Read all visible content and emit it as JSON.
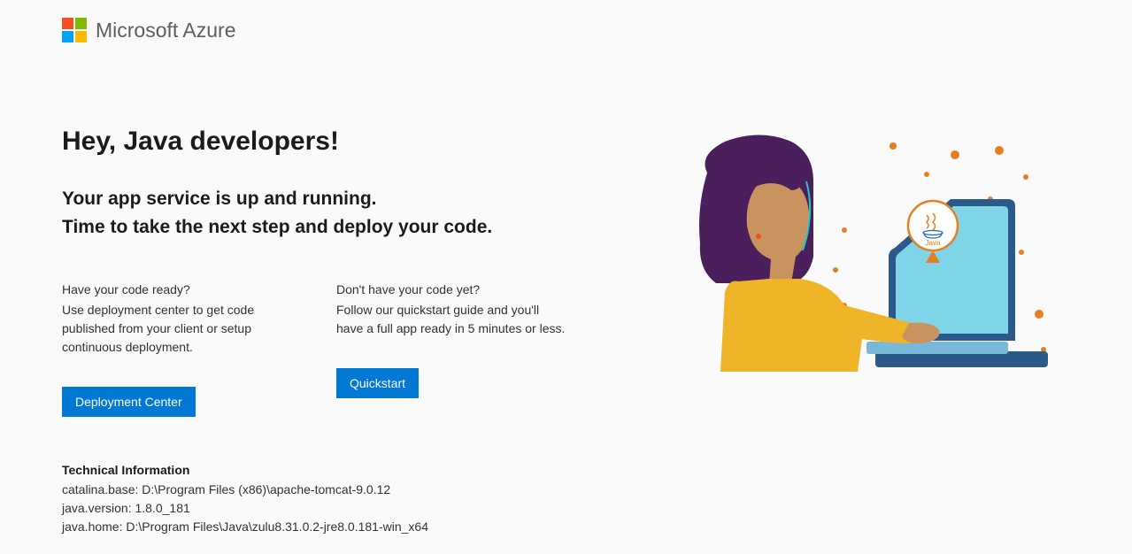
{
  "brand": "Microsoft Azure",
  "heading": "Hey, Java developers!",
  "subheading_line1": "Your app service is up and running.",
  "subheading_line2": "Time to take the next step and deploy your code.",
  "col1": {
    "question": "Have your code ready?",
    "body": "Use deployment center to get code published from your client or setup continuous deployment.",
    "button": "Deployment Center"
  },
  "col2": {
    "question": "Don't have your code yet?",
    "body": "Follow our quickstart guide and you'll have a full app ready in 5 minutes or less.",
    "button": "Quickstart"
  },
  "tech": {
    "title": "Technical Information",
    "catalina_base": "catalina.base: D:\\Program Files (x86)\\apache-tomcat-9.0.12",
    "java_version": "java.version: 1.8.0_181",
    "java_home": "java.home: D:\\Program Files\\Java\\zulu8.31.0.2-jre8.0.181-win_x64"
  }
}
